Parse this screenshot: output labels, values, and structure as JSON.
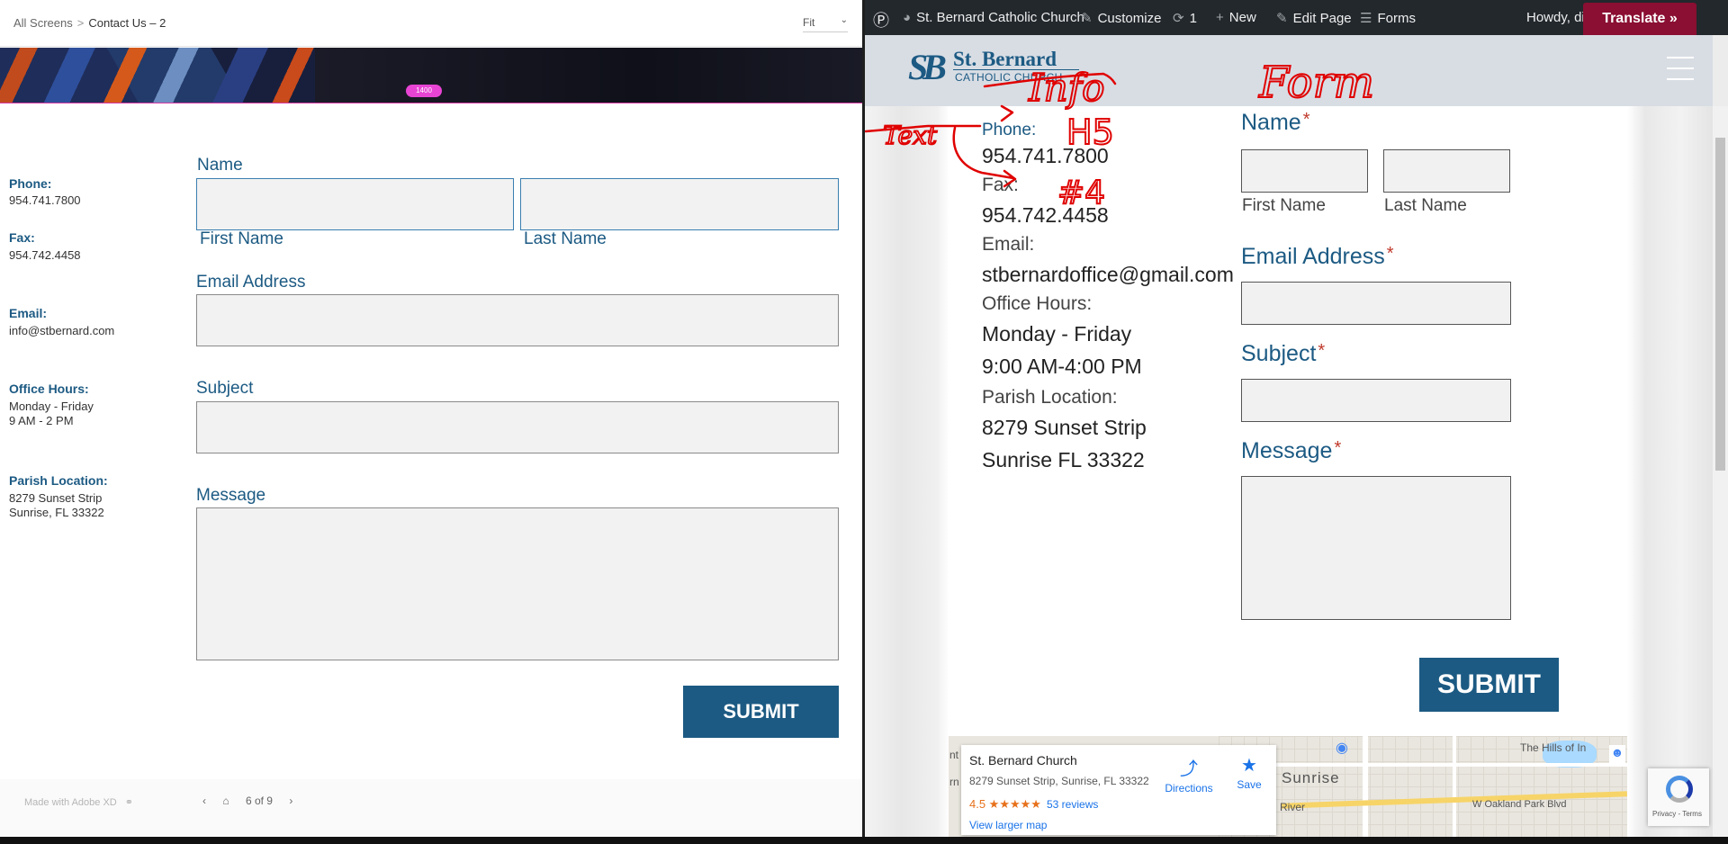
{
  "xd": {
    "breadcrumb": {
      "root": "All Screens",
      "separator": ">",
      "current": "Contact Us – 2"
    },
    "zoom": {
      "value": "Fit"
    },
    "artboard_width_badge": "1400",
    "contact": {
      "phone_label": "Phone:",
      "phone": "954.741.7800",
      "fax_label": "Fax:",
      "fax": "954.742.4458",
      "email_label": "Email:",
      "email": "info@stbernard.com",
      "hours_label": "Office Hours:",
      "hours_days": "Monday - Friday",
      "hours_time": "9 AM - 2 PM",
      "location_label": "Parish Location:",
      "location_street": "8279 Sunset Strip",
      "location_city": "Sunrise, FL 33322"
    },
    "form": {
      "name_label": "Name",
      "first_name": "First Name",
      "last_name": "Last Name",
      "email_label": "Email Address",
      "subject_label": "Subject",
      "message_label": "Message",
      "submit": "SUBMIT"
    },
    "footer": {
      "made_with": "Made with Adobe XD",
      "page": "6 of 9"
    }
  },
  "wp": {
    "adminbar": {
      "site": "St. Bernard Catholic Church",
      "customize": "Customize",
      "updates": "1",
      "new": "New",
      "edit_page": "Edit Page",
      "forms": "Forms",
      "howdy": "Howdy, dic",
      "translate": "Translate »"
    },
    "logo": {
      "mark": "SB",
      "name": "St. Bernard",
      "sub": "CATHOLIC CHURCH"
    },
    "contact": {
      "phone_label": "Phone:",
      "phone": "954.741.7800",
      "fax_label": "Fax:",
      "fax": "954.742.4458",
      "email_label": "Email:",
      "email": "stbernardoffice@gmail.com",
      "hours_label": "Office Hours:",
      "hours_days": "Monday - Friday",
      "hours_time": "9:00 AM-4:00 PM",
      "location_label": "Parish Location:",
      "location_street": "8279 Sunset Strip",
      "location_city": "Sunrise FL 33322"
    },
    "form": {
      "name_label": "Name",
      "required": "*",
      "first_name": "First Name",
      "last_name": "Last Name",
      "email_label": "Email Address",
      "subject_label": "Subject",
      "message_label": "Message",
      "submit": "SUBMIT"
    },
    "map": {
      "place": "St. Bernard Church",
      "address": "8279 Sunset Strip, Sunrise, FL 33322",
      "rating": "4.5 ★★★★★",
      "reviews": "53 reviews",
      "larger": "View larger map",
      "directions": "Directions",
      "save": "Save",
      "labels": {
        "sunrise": "Sunrise",
        "hills": "The Hills of In",
        "park": "W Oakland Park Blvd",
        "river": "River",
        "nt": "nt",
        "rn": "rn"
      }
    },
    "recaptcha": "Privacy - Terms",
    "annotations": {
      "info": "Info",
      "form": "Form",
      "h5": "H5",
      "text": "Text",
      "h4": "#4"
    }
  },
  "colors": {
    "brand_blue": "#1c5a83",
    "annotation_red": "#e00000",
    "translate_red": "#8a0f32",
    "wp_adminbar": "#23282d"
  }
}
